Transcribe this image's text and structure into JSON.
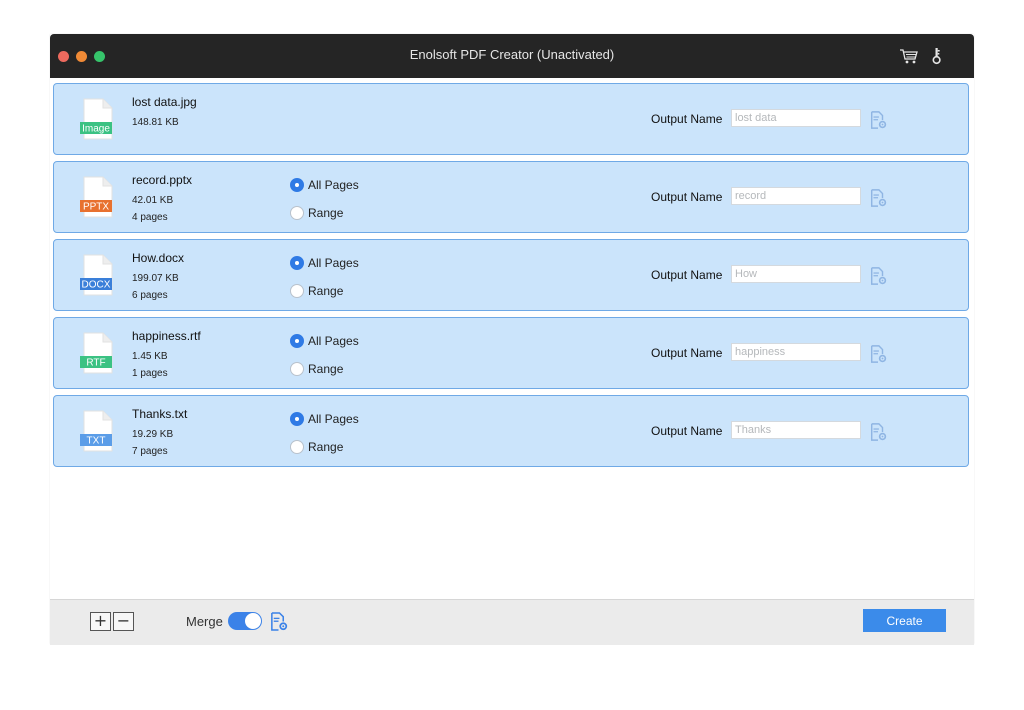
{
  "window": {
    "title": "Enolsoft PDF Creator (Unactivated)"
  },
  "titlebar_icons": [
    {
      "icon": "cart-icon"
    },
    {
      "icon": "key-icon"
    }
  ],
  "output_label": "Output Name",
  "radio": {
    "all_pages": "All Pages",
    "range": "Range"
  },
  "files": [
    {
      "name": "lost data.jpg",
      "size": "148.81 KB",
      "pages": "",
      "type_label": "Image",
      "type_color": "#3bc283",
      "output_placeholder": "lost data",
      "page_options": false,
      "selected": "all"
    },
    {
      "name": "record.pptx",
      "size": "42.01 KB",
      "pages": "4 pages",
      "type_label": "PPTX",
      "type_color": "#e8712f",
      "output_placeholder": "record",
      "page_options": true,
      "selected": "all"
    },
    {
      "name": "How.docx",
      "size": "199.07 KB",
      "pages": "6 pages",
      "type_label": "DOCX",
      "type_color": "#3a7fd9",
      "output_placeholder": "How",
      "page_options": true,
      "selected": "all"
    },
    {
      "name": "happiness.rtf",
      "size": "1.45 KB",
      "pages": "1 pages",
      "type_label": "RTF",
      "type_color": "#3bc283",
      "output_placeholder": "happiness",
      "page_options": true,
      "selected": "all"
    },
    {
      "name": "Thanks.txt",
      "size": "19.29 KB",
      "pages": "7 pages",
      "type_label": "TXT",
      "type_color": "#5b9de8",
      "output_placeholder": "Thanks",
      "page_options": true,
      "selected": "all"
    }
  ],
  "bottom": {
    "add_label": "+",
    "remove_label": "−",
    "merge_label": "Merge",
    "merge_on": true,
    "create_label": "Create"
  },
  "colors": {
    "accent": "#3b8bea",
    "row_bg": "#cbe4fb",
    "row_border": "#6fa9e6",
    "titlebar": "#252525"
  }
}
